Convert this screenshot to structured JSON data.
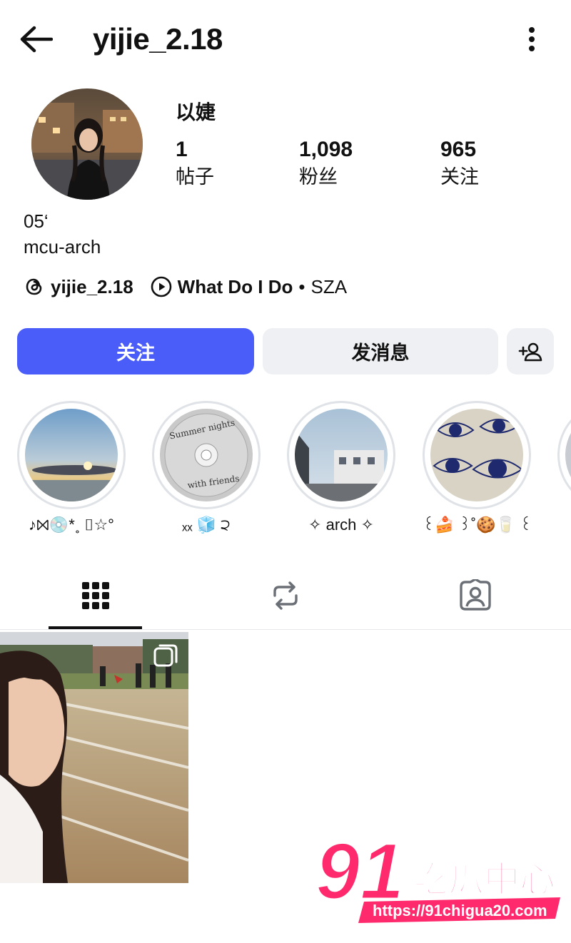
{
  "header": {
    "title": "yijie_2.18"
  },
  "profile": {
    "display_name": "以婕",
    "stats": [
      {
        "value": "1",
        "label": "帖子"
      },
      {
        "value": "1,098",
        "label": "粉丝"
      },
      {
        "value": "965",
        "label": "关注"
      }
    ],
    "bio_lines": [
      "05‘",
      "mcu-arch"
    ],
    "threads_handle": "yijie_2.18",
    "music": {
      "song": "What Do I Do",
      "separator": "•",
      "artist": "SZA"
    }
  },
  "actions": {
    "follow_label": "关注",
    "message_label": "发消息"
  },
  "highlights": [
    {
      "label": "♪⨝💿*˳ ⌷☆°"
    },
    {
      "label": "ₓₓ 🧊 ੨"
    },
    {
      "label": "✧ arch ✧"
    },
    {
      "label": "꒰🍰 ꒱˚🍪🥛 ꒰"
    }
  ],
  "highlight_art_text": {
    "line1": "Summer nights",
    "line2": "with friends"
  },
  "tabs": [
    "posts-grid",
    "reposts",
    "tagged"
  ],
  "colors": {
    "primary": "#4a5df9",
    "secondary_button": "#eef0f3"
  },
  "watermark": {
    "brand": "91",
    "name": "吃瓜中心",
    "url": "https://91chigua20.com"
  }
}
